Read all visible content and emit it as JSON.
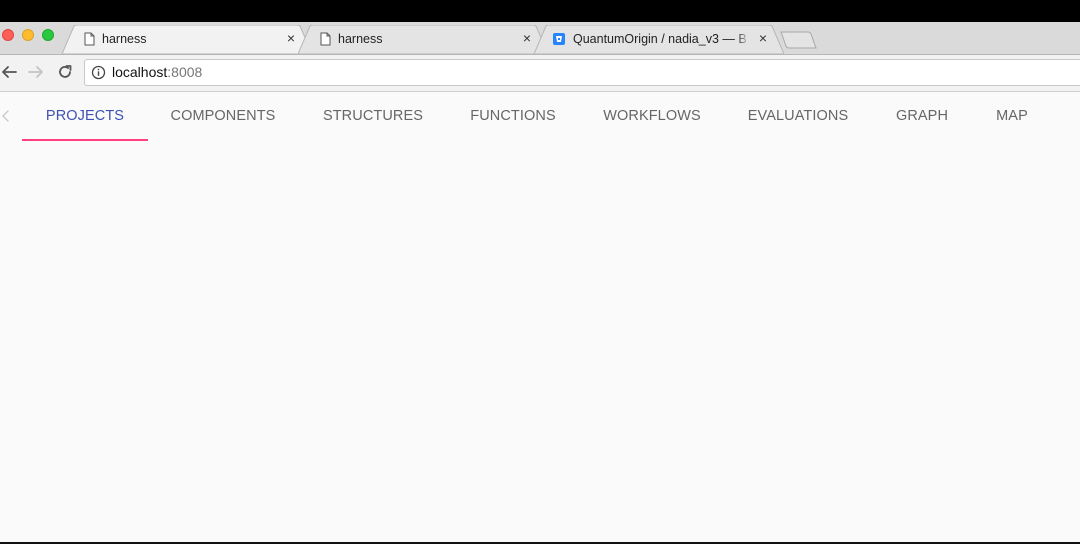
{
  "browser": {
    "tabs": [
      {
        "title": "harness",
        "icon": "file-icon",
        "active": true
      },
      {
        "title": "harness",
        "icon": "file-icon",
        "active": false
      },
      {
        "title": "QuantumOrigin / nadia_v3 — B",
        "icon": "bitbucket-icon",
        "active": false
      }
    ],
    "close_glyph": "×",
    "address": {
      "host": "localhost",
      "port": ":8008"
    }
  },
  "app": {
    "nav_tabs": [
      {
        "label": "PROJECTS",
        "active": true
      },
      {
        "label": "COMPONENTS",
        "active": false
      },
      {
        "label": "STRUCTURES",
        "active": false
      },
      {
        "label": "FUNCTIONS",
        "active": false
      },
      {
        "label": "WORKFLOWS",
        "active": false
      },
      {
        "label": "EVALUATIONS",
        "active": false
      },
      {
        "label": "GRAPH",
        "active": false
      },
      {
        "label": "MAP",
        "active": false
      }
    ]
  },
  "colors": {
    "active_tab_text": "#3f51b5",
    "ink_bar": "#ff4081",
    "inactive_tab_text": "#666666",
    "page_background": "#fafafa"
  }
}
